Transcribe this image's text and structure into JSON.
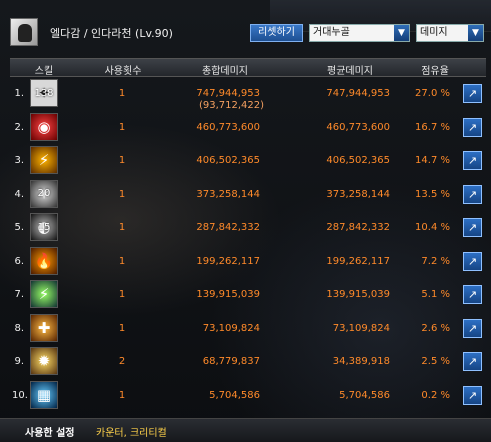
{
  "header": {
    "character_name": "엘다감 / 인다라천 (Lv.90)",
    "reset_label": "리셋하기",
    "target_select": "거대누골",
    "metric_select": "데미지"
  },
  "columns": {
    "skill": "스킬",
    "uses": "사용횟수",
    "total": "총합데미지",
    "average": "평균데미지",
    "share": "점유율"
  },
  "rows": [
    {
      "rank": "1.",
      "icon": "skill-1-icon",
      "cooldown": "138",
      "uses": "1",
      "total": "747,944,953",
      "total_sub": "(93,712,422)",
      "average": "747,944,953",
      "share": "27.0 %"
    },
    {
      "rank": "2.",
      "icon": "skill-2-icon",
      "cooldown": "",
      "uses": "1",
      "total": "460,773,600",
      "total_sub": "",
      "average": "460,773,600",
      "share": "16.7 %"
    },
    {
      "rank": "3.",
      "icon": "skill-3-icon",
      "cooldown": "",
      "uses": "1",
      "total": "406,502,365",
      "total_sub": "",
      "average": "406,502,365",
      "share": "14.7 %"
    },
    {
      "rank": "4.",
      "icon": "skill-4-icon",
      "cooldown": "20",
      "uses": "1",
      "total": "373,258,144",
      "total_sub": "",
      "average": "373,258,144",
      "share": "13.5 %"
    },
    {
      "rank": "5.",
      "icon": "skill-5-icon",
      "cooldown": "15",
      "uses": "1",
      "total": "287,842,332",
      "total_sub": "",
      "average": "287,842,332",
      "share": "10.4 %"
    },
    {
      "rank": "6.",
      "icon": "skill-6-icon",
      "cooldown": "",
      "uses": "1",
      "total": "199,262,117",
      "total_sub": "",
      "average": "199,262,117",
      "share": "7.2 %"
    },
    {
      "rank": "7.",
      "icon": "skill-7-icon",
      "cooldown": "",
      "uses": "1",
      "total": "139,915,039",
      "total_sub": "",
      "average": "139,915,039",
      "share": "5.1 %"
    },
    {
      "rank": "8.",
      "icon": "skill-8-icon",
      "cooldown": "",
      "uses": "1",
      "total": "73,109,824",
      "total_sub": "",
      "average": "73,109,824",
      "share": "2.6 %"
    },
    {
      "rank": "9.",
      "icon": "skill-9-icon",
      "cooldown": "",
      "uses": "2",
      "total": "68,779,837",
      "total_sub": "",
      "average": "34,389,918",
      "share": "2.5 %"
    },
    {
      "rank": "10.",
      "icon": "skill-10-icon",
      "cooldown": "",
      "uses": "1",
      "total": "5,704,586",
      "total_sub": "",
      "average": "5,704,586",
      "share": "0.2 %"
    }
  ],
  "footer": {
    "label": "사용한 설정",
    "value": "카운터, 크리티컬"
  },
  "colors": {
    "value_orange": "#ff8a2a",
    "button_blue": "#2d6fc4",
    "footer_yellow": "#ffd24a"
  }
}
